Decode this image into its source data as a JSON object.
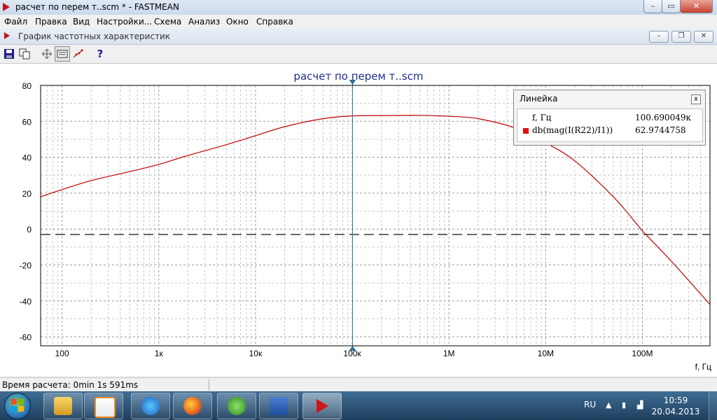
{
  "window": {
    "title": "расчет по перем т..scm * - FASTMEAN",
    "minimize": "–",
    "maximize": "▭",
    "close": "✕"
  },
  "menu": [
    "Файл",
    "Правка",
    "Вид",
    "Настройки...",
    "Схема",
    "Анализ",
    "Окно",
    "Справка"
  ],
  "child_window": {
    "title": "График частотных характеристик",
    "minimize": "–",
    "restore": "❐",
    "close": "✕"
  },
  "toolbar": {
    "icons": [
      "save-icon",
      "copy-icon",
      "move-icon",
      "ruler-icon",
      "curve-points-icon",
      "help-icon"
    ],
    "help_label": "?"
  },
  "chart_data": {
    "type": "line",
    "title": "расчет по перем т..scm",
    "xlabel": "f, Гц",
    "ylabel": "",
    "x_scale": "log",
    "xlim": [
      60,
      500000000
    ],
    "ylim": [
      -65,
      80
    ],
    "x_tick_values": [
      100,
      1000,
      10000,
      100000,
      1000000,
      10000000,
      100000000
    ],
    "x_tick_labels": [
      "100",
      "1к",
      "10к",
      "100к",
      "1M",
      "10M",
      "100M"
    ],
    "y_ticks": [
      80,
      60,
      40,
      20,
      0,
      -20,
      -40,
      -60
    ],
    "grid": true,
    "reference_line_y": 0,
    "cursor_x": 100690,
    "series": [
      {
        "name": "db(mag(I(R22)/I1))",
        "color": "#c00000",
        "x": [
          60,
          100,
          200,
          500,
          1000,
          2000,
          5000,
          10000,
          20000,
          50000,
          100000,
          200000,
          500000,
          1000000,
          2000000,
          5000000,
          10000000,
          20000000,
          50000000,
          90000000,
          100000000,
          200000000,
          500000000
        ],
        "y": [
          18,
          22,
          27,
          32,
          36,
          41,
          47,
          52,
          57,
          61.5,
          63,
          63.2,
          63.3,
          62.8,
          61.5,
          56,
          48,
          38,
          18,
          2,
          -1,
          -18,
          -42
        ]
      }
    ]
  },
  "ruler": {
    "title": "Линейка",
    "close": "x",
    "x_name": "f, Гц",
    "x_value": "100.690049к",
    "y_name": "db(mag(I(R22)/I1))",
    "y_value": "62.9744758",
    "y_color": "#e01010"
  },
  "status": {
    "text": "Время расчета: 0min 1s 591ms"
  },
  "taskbar": {
    "apps": [
      "explorer-icon",
      "media-player-icon",
      "internet-explorer-icon",
      "firefox-icon",
      "utorrent-icon",
      "word-icon",
      "fastmean-icon"
    ],
    "language": "RU",
    "time": "10:59",
    "date": "20.04.2013"
  }
}
